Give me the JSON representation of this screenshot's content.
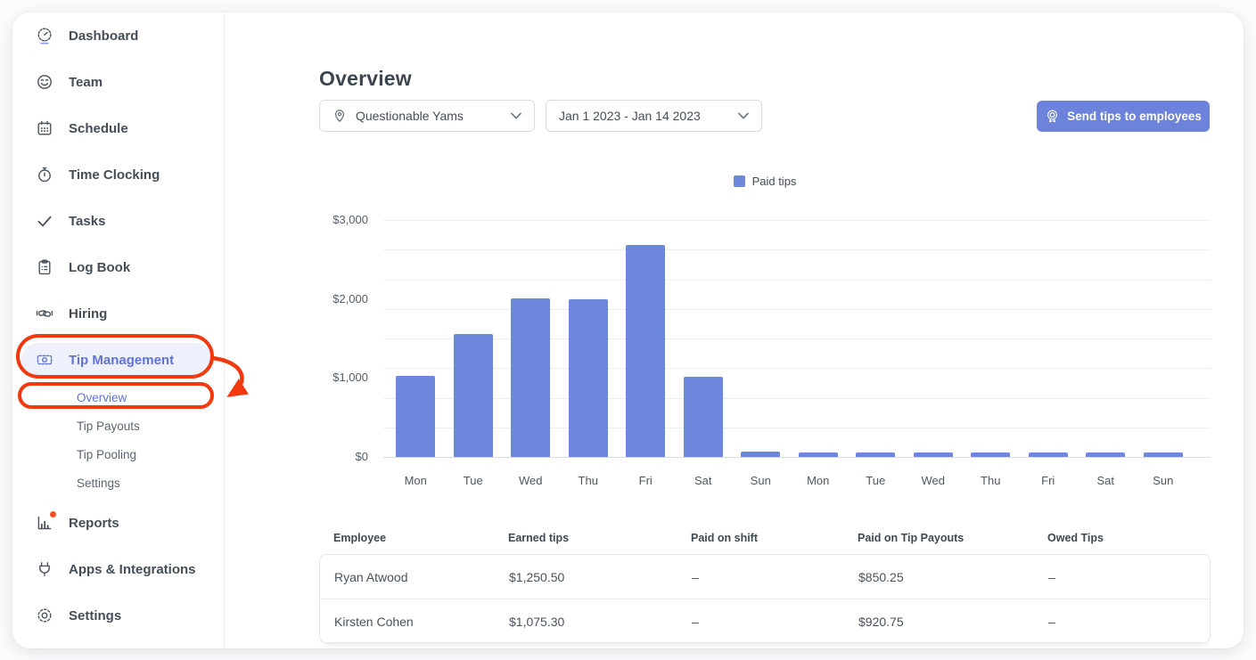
{
  "app": {
    "accent_color": "#6C82DB",
    "annotation_color": "#F2380E",
    "active_pill_color": "#EEF0FB",
    "active_text_color": "#5F73D7"
  },
  "sidebar": {
    "items": [
      {
        "label": "Dashboard",
        "icon": "gauge-icon",
        "type": "item"
      },
      {
        "label": "Team",
        "icon": "smiley-icon",
        "type": "item"
      },
      {
        "label": "Schedule",
        "icon": "calendar-icon",
        "type": "item"
      },
      {
        "label": "Time Clocking",
        "icon": "stopwatch-icon",
        "type": "item"
      },
      {
        "label": "Tasks",
        "icon": "checkmark-icon",
        "type": "item"
      },
      {
        "label": "Log Book",
        "icon": "clipboard-icon",
        "type": "item"
      },
      {
        "label": "Hiring",
        "icon": "handshake-icon",
        "type": "item"
      },
      {
        "label": "Tip Management",
        "icon": "money-bill-icon",
        "type": "item",
        "active": true,
        "annotated": true
      },
      {
        "label": "Overview",
        "type": "subitem",
        "active": true,
        "annotated": true
      },
      {
        "label": "Tip Payouts",
        "type": "subitem"
      },
      {
        "label": "Tip Pooling",
        "type": "subitem"
      },
      {
        "label": "Settings",
        "type": "subitem"
      },
      {
        "label": "Reports",
        "icon": "bar-chart-icon",
        "type": "item",
        "notification_dot": true,
        "gap_before": true
      },
      {
        "label": "Apps & Integrations",
        "icon": "plug-icon",
        "type": "item"
      },
      {
        "label": "Settings",
        "icon": "gear-icon",
        "type": "item"
      }
    ]
  },
  "main": {
    "title": "Overview",
    "filters": {
      "location": {
        "value": "Questionable Yams",
        "icon": "map-pin-icon",
        "chevron": "chevron-down-icon"
      },
      "date_range": {
        "value": "Jan 1 2023 - Jan 14 2023",
        "chevron": "chevron-down-icon"
      }
    },
    "send_tips_button": {
      "label": "Send tips to employees",
      "icon": "ribbon-badge-icon"
    },
    "legend": {
      "label": "Paid tips",
      "swatch_color": "#6D87DC"
    }
  },
  "chart_data": {
    "type": "bar",
    "series_name": "Paid tips",
    "categories": [
      "Mon",
      "Tue",
      "Wed",
      "Thu",
      "Fri",
      "Sat",
      "Sun",
      "Mon",
      "Tue",
      "Wed",
      "Thu",
      "Fri",
      "Sat",
      "Sun"
    ],
    "values": [
      1030,
      1560,
      2010,
      2000,
      2690,
      1020,
      70,
      55,
      55,
      55,
      55,
      55,
      55,
      55
    ],
    "y_ticks": [
      {
        "label": "$0",
        "value": 0
      },
      {
        "label": "$1,000",
        "value": 1000
      },
      {
        "label": "$2,000",
        "value": 2000
      },
      {
        "label": "$3,000",
        "value": 3000
      }
    ],
    "ylim": [
      0,
      3000
    ],
    "grid": true,
    "legend_position": "top-center",
    "bar_color": "#6D87DC"
  },
  "table": {
    "columns": [
      "Employee",
      "Earned tips",
      "Paid on shift",
      "Paid on Tip Payouts",
      "Owed Tips"
    ],
    "rows": [
      [
        "Ryan Atwood",
        "$1,250.50",
        "–",
        "$850.25",
        "–"
      ],
      [
        "Kirsten Cohen",
        "$1,075.30",
        "–",
        "$920.75",
        "–"
      ]
    ]
  },
  "annotations": {
    "color": "#F2380E",
    "shapes": [
      "oval-around-tip-management",
      "oval-around-overview",
      "curved-arrow-to-overview"
    ]
  }
}
